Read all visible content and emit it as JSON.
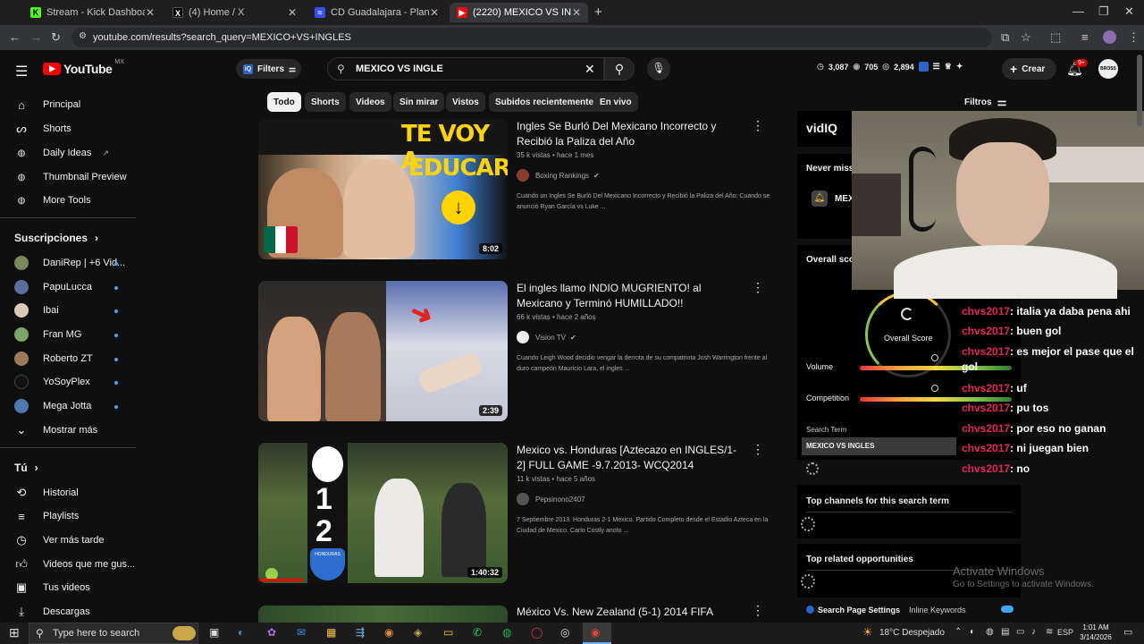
{
  "browser": {
    "tabs": [
      {
        "title": "Stream - Kick Dashboard",
        "icon": "kick-icon",
        "color": "#53fc18"
      },
      {
        "title": "(4) Home / X",
        "icon": "x-icon",
        "color": "#000000"
      },
      {
        "title": "CD Guadalajara - Plantilla detal",
        "icon": "sofascore-icon",
        "color": "#374df5"
      },
      {
        "title": "(2220) MEXICO VS INGLES - You",
        "icon": "youtube-icon",
        "color": "#ff0000"
      }
    ],
    "url": "youtube.com/results?search_query=MEXICO+VS+INGLES"
  },
  "youtube": {
    "logo": "YouTube",
    "region": "MX",
    "filters_button": "Filters",
    "search_value": "MEXICO VS INGLE",
    "stats": {
      "a": "3,087",
      "b": "705",
      "c": "2,894"
    },
    "create_label": "Crear",
    "notif_badge": "9+",
    "avatar_text": "BROSS",
    "sidebar": {
      "main": [
        {
          "label": "Principal",
          "icon": "home-icon"
        },
        {
          "label": "Shorts",
          "icon": "shorts-icon"
        },
        {
          "label": "Daily Ideas",
          "icon": "vidiq-icon"
        },
        {
          "label": "Thumbnail Preview",
          "icon": "vidiq-icon"
        },
        {
          "label": "More Tools",
          "icon": "vidiq-icon"
        }
      ],
      "subs_title": "Suscripciones",
      "subs": [
        {
          "label": "DaniRep | +6 Vid...",
          "color": "#7a8a5c"
        },
        {
          "label": "PapuLucca",
          "color": "#5a6e9c"
        },
        {
          "label": "Ibai",
          "color": "#d9c9b9"
        },
        {
          "label": "Fran MG",
          "color": "#7ca36a"
        },
        {
          "label": "Roberto ZT",
          "color": "#9c7a5a"
        },
        {
          "label": "YoSoyPlex",
          "color": "#111111"
        },
        {
          "label": "Mega Jotta",
          "color": "#4c7ab0"
        }
      ],
      "show_more": "Mostrar más",
      "you_title": "Tú",
      "you": [
        {
          "label": "Historial",
          "icon": "history-icon"
        },
        {
          "label": "Playlists",
          "icon": "playlist-icon"
        },
        {
          "label": "Ver más tarde",
          "icon": "clock-icon"
        },
        {
          "label": "Videos que me gus...",
          "icon": "thumbs-up-icon"
        },
        {
          "label": "Tus videos",
          "icon": "video-icon"
        },
        {
          "label": "Descargas",
          "icon": "download-icon"
        }
      ]
    },
    "chips": [
      "Todo",
      "Shorts",
      "Videos",
      "Sin mirar",
      "Vistos",
      "Subidos recientemente",
      "En vivo"
    ],
    "filtros_label": "Filtros",
    "videos": [
      {
        "title": "Ingles Se Burló Del Mexicano Incorrecto y Recibió la Paliza del Año",
        "meta": "35 k vistas • hace 1 mes",
        "channel": "Boxing Rankings",
        "verified": "✔",
        "desc": "Cuando un Ingles Se Burló Del Mexicano Incorrecto y Recibió la Paliza del Año: Cuando se anunció Ryan García vs Luke ...",
        "duration": "8:02",
        "thumb_text_1": "TE VOY A",
        "thumb_text_2": "EDUCAR"
      },
      {
        "title": "El ingles llamo INDIO MUGRIENTO! al Mexicano y Terminó HUMILLADO!!",
        "meta": "66 k vistas • hace 2 años",
        "channel": "Vision TV",
        "verified": "✔",
        "desc": "Cuando Leigh Wood decidio vengar la derrota de su compatriota Josh Warrington frente al duro campeón Mauricio Lara, el ingles ...",
        "duration": "2:39"
      },
      {
        "title": "Mexico vs. Honduras [Aztecazo en INGLES/1-2] FULL GAME -9.7.2013- WCQ2014",
        "meta": "11 k vistas • hace 5 años",
        "channel": "Pepsinono2407",
        "desc": "7 Septiembre 2013. Honduras 2-1 Mexico. Partido Completo desde el Estadio Azteca en la Ciudad de Mexico. Carlo Costly anoto ...",
        "duration": "1:40:32",
        "score_top": "1",
        "score_bottom": "2",
        "team_label": "HONDURAS"
      },
      {
        "title": "México Vs. New Zealand (5-1) 2014 FIFA"
      }
    ]
  },
  "vidiq": {
    "logo": "vidIQ",
    "never_miss": "Never miss",
    "alert_term": "MEX",
    "overall_score": "Overall sco",
    "overall_score_label": "Overall Score",
    "volume": "Volume",
    "competition": "Competition",
    "search_term_label": "Search Term",
    "search_term": "MEXICO VS INGLES",
    "top_channels": "Top channels for this search term",
    "top_related": "Top related opportunities",
    "page_settings": "Search Page Settings",
    "inline_keywords": "Inline Keywords"
  },
  "chat": [
    {
      "user": "chvs2017",
      "text": "italia ya daba pena ahi"
    },
    {
      "user": "chvs2017",
      "text": "buen gol"
    },
    {
      "user": "chvs2017",
      "text": "es mejor el pase que el gol"
    },
    {
      "user": "chvs2017",
      "text": "uf"
    },
    {
      "user": "chvs2017",
      "text": "pu tos"
    },
    {
      "user": "chvs2017",
      "text": "por eso no ganan"
    },
    {
      "user": "chvs2017",
      "text": "ni juegan bien"
    },
    {
      "user": "chvs2017",
      "text": "no"
    }
  ],
  "watermark": {
    "line1": "Activate Windows",
    "line2": "Go to Settings to activate Windows."
  },
  "taskbar": {
    "search_placeholder": "Type here to search",
    "weather": "18°C  Despejado",
    "lang": "ESP",
    "time": "1:01 AM",
    "date": "3/14/2026"
  }
}
